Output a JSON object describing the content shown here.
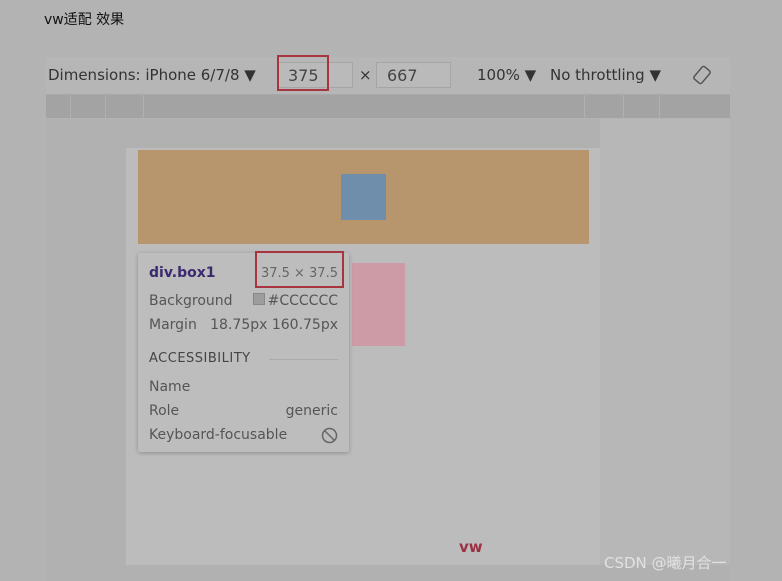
{
  "post_title": "vw适配 效果",
  "toolbar": {
    "dimensions_label": "Dimensions: iPhone 6/7/8 ▼",
    "width_value": "375",
    "times": "×",
    "height_value": "667",
    "zoom": "100% ▼",
    "throttling": "No throttling ▼",
    "rotate_icon": "rotate-icon"
  },
  "tooltip": {
    "selector": "div.box1",
    "size": "37.5 × 37.5",
    "background_label": "Background",
    "background_value": "#CCCCCC",
    "margin_label": "Margin",
    "margin_value": "18.75px 160.75px",
    "section": "ACCESSIBILITY",
    "name_label": "Name",
    "role_label": "Role",
    "role_value": "generic",
    "focus_label": "Keyboard-focusable",
    "focus_icon": "not-allowed-icon"
  },
  "page_text": "vw",
  "watermark": "CSDN @曦月合一",
  "colors": {
    "highlight": "#a8343f",
    "orange": "#b8966d",
    "blue": "#6f8eab",
    "pink": "#cc9ba6"
  }
}
